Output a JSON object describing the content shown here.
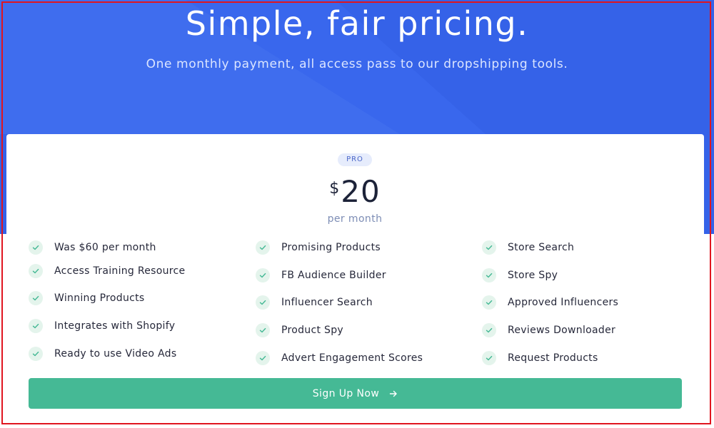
{
  "hero": {
    "title": "Simple, fair pricing.",
    "subtitle": "One monthly payment, all access pass to our dropshipping tools."
  },
  "plan": {
    "badge": "PRO",
    "currency": "$",
    "amount": "20",
    "period": "per month"
  },
  "features": {
    "col1": [
      {
        "label": "Was $60 per month",
        "icon": "check-icon"
      },
      {
        "label": "Access Training Resource",
        "icon": "check-icon"
      },
      {
        "label": "Winning Products",
        "icon": "check-icon"
      },
      {
        "label": "Integrates with Shopify",
        "icon": "check-icon"
      },
      {
        "label": "Ready to use Video Ads",
        "icon": "check-icon"
      }
    ],
    "col2": [
      {
        "label": "Promising Products",
        "icon": "check-icon"
      },
      {
        "label": "FB Audience Builder",
        "icon": "check-icon"
      },
      {
        "label": "Influencer Search",
        "icon": "check-icon"
      },
      {
        "label": "Product Spy",
        "icon": "check-icon"
      },
      {
        "label": "Advert Engagement Scores",
        "icon": "check-icon"
      }
    ],
    "col3": [
      {
        "label": "Store Search",
        "icon": "check-icon"
      },
      {
        "label": "Store Spy",
        "icon": "check-icon"
      },
      {
        "label": "Approved Influencers",
        "icon": "check-icon"
      },
      {
        "label": "Reviews Downloader",
        "icon": "check-icon"
      },
      {
        "label": "Request Products",
        "icon": "check-icon"
      }
    ]
  },
  "cta": {
    "label": "Sign Up Now",
    "icon": "arrow-right-icon"
  },
  "colors": {
    "hero_background": "#3562e8",
    "accent_green": "#45b995",
    "badge_background": "#e6ecfc"
  }
}
